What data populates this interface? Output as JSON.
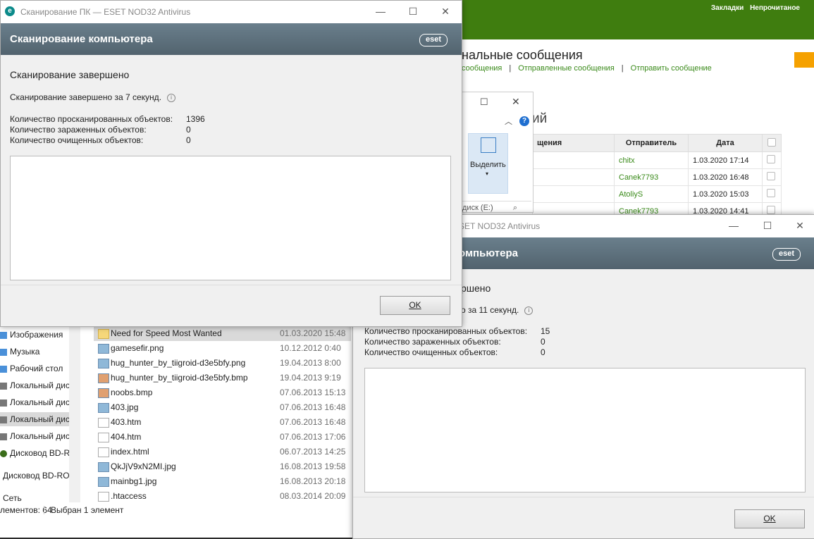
{
  "browser": {
    "links": [
      "Закладки",
      "Непрочитаное"
    ],
    "heading": "нальные сообщения",
    "nav": [
      "сообщения",
      "Отправленные сообщения",
      "Отправить сообщение"
    ],
    "subheading": "ий",
    "columns": [
      "щения",
      "Отправитель",
      "Дата"
    ],
    "rows": [
      {
        "sender": "chitx",
        "date": "1.03.2020 17:14"
      },
      {
        "sender": "Canek7793",
        "date": "1.03.2020 16:48"
      },
      {
        "sender": "AtoliyS",
        "date": "1.03.2020 15:03"
      },
      {
        "sender": "Canek7793",
        "date": "1.03.2020 14:41"
      }
    ]
  },
  "small_explorer": {
    "select_label": "Выделить",
    "search_placeholder": "диск (E:)"
  },
  "explorer": {
    "nav": [
      "Изображения",
      "Музыка",
      "Рабочий стол",
      "Локальный дис",
      "Локальный дис",
      "Локальный дис",
      "Локальный дис",
      "Дисковод BD-RO",
      "Дисковод BD-RO",
      "Сеть"
    ],
    "files": [
      {
        "name": "Need for Speed Most Wanted",
        "date": "01.03.2020 15:48"
      },
      {
        "name": "gamesefir.png",
        "date": "10.12.2012 0:40"
      },
      {
        "name": "hug_hunter_by_tiigroid-d3e5bfy.png",
        "date": "19.04.2013 8:00"
      },
      {
        "name": "hug_hunter_by_tiigroid-d3e5bfy.bmp",
        "date": "19.04.2013 9:19"
      },
      {
        "name": "noobs.bmp",
        "date": "07.06.2013 15:13"
      },
      {
        "name": "403.jpg",
        "date": "07.06.2013 16:48"
      },
      {
        "name": "403.htm",
        "date": "07.06.2013 16:48"
      },
      {
        "name": "404.htm",
        "date": "07.06.2013 17:06"
      },
      {
        "name": "index.html",
        "date": "06.07.2013 14:25"
      },
      {
        "name": "QkJjV9xN2MI.jpg",
        "date": "16.08.2013 19:58"
      },
      {
        "name": "mainbg1.jpg",
        "date": "16.08.2013 20:18"
      },
      {
        "name": ".htaccess",
        "date": "08.03.2014 20:09"
      }
    ],
    "status_count": "лементов: 64",
    "status_selected": "Выбран 1 элемент"
  },
  "dialog1": {
    "title": "Сканирование ПК — ESET NOD32 Antivirus",
    "header": "Сканирование компьютера",
    "status": "Сканирование завершено",
    "duration": "Сканирование завершено за 7 секунд.",
    "scanned_label": "Количество просканированных объектов:",
    "scanned_value": "1396",
    "infected_label": "Количество зараженных объектов:",
    "infected_value": "0",
    "cleaned_label": "Количество очищенных объектов:",
    "cleaned_value": "0",
    "ok": "OK"
  },
  "dialog2": {
    "title": "SET NOD32 Antivirus",
    "header": "омпьютера",
    "status": "ршено",
    "duration": "о за 11 секунд.",
    "scanned_label": "Количество просканированных объектов:",
    "scanned_value": "15",
    "infected_label": "Количество зараженных объектов:",
    "infected_value": "0",
    "cleaned_label": "Количество очищенных объектов:",
    "cleaned_value": "0",
    "ok": "OK"
  },
  "logo_text": "eset",
  "colors": {
    "accent_green": "#3f7d0f",
    "eset_header": "#5e717c",
    "link_green": "#3a8a1a"
  }
}
